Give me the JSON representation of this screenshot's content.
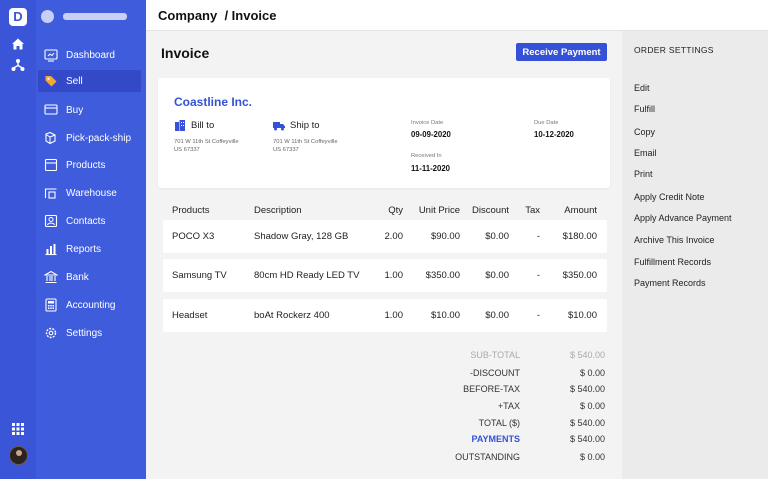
{
  "rail": {
    "logo": "D"
  },
  "sidebar": {
    "items": [
      {
        "label": "Dashboard",
        "icon": "dashboard-icon",
        "active": false
      },
      {
        "label": "Sell",
        "icon": "tag-icon",
        "active": true
      },
      {
        "label": "Buy",
        "icon": "cart-icon",
        "active": false
      },
      {
        "label": "Pick-pack-ship",
        "icon": "box-icon",
        "active": false
      },
      {
        "label": "Products",
        "icon": "products-icon",
        "active": false
      },
      {
        "label": "Warehouse",
        "icon": "warehouse-icon",
        "active": false
      },
      {
        "label": "Contacts",
        "icon": "contacts-icon",
        "active": false
      },
      {
        "label": "Reports",
        "icon": "reports-icon",
        "active": false
      },
      {
        "label": "Bank",
        "icon": "bank-icon",
        "active": false
      },
      {
        "label": "Accounting",
        "icon": "accounting-icon",
        "active": false
      },
      {
        "label": "Settings",
        "icon": "gear-icon",
        "active": false
      }
    ]
  },
  "header": {
    "breadcrumb": "Company  / Invoice"
  },
  "main": {
    "title": "Invoice",
    "receive_payment_label": "Receive Payment"
  },
  "invoice": {
    "company": "Coastline Inc.",
    "bill_to_label": "Bill to",
    "ship_to_label": "Ship to",
    "bill_to_address": [
      "701 W 11th St Coffeyville",
      "US 67337"
    ],
    "ship_to_address": [
      "701 W 11th St Coffeyville",
      "US 67337"
    ],
    "invoice_date_label": "Invoice Date",
    "invoice_date": "09-09-2020",
    "due_date_label": "Due Date",
    "due_date": "10-12-2020",
    "received_in_label": "Received In",
    "received_in": "11-11-2020"
  },
  "table": {
    "headers": [
      "Products",
      "Description",
      "Qty",
      "Unit Price",
      "Discount",
      "Tax",
      "Amount"
    ],
    "rows": [
      [
        "POCO X3",
        "Shadow Gray, 128 GB",
        "2.00",
        "$90.00",
        "$0.00",
        "-",
        "$180.00"
      ],
      [
        "Samsung TV",
        "80cm HD Ready LED TV",
        "1.00",
        "$350.00",
        "$0.00",
        "-",
        "$350.00"
      ],
      [
        "Headset",
        "boAt Rockerz 400",
        "1.00",
        "$10.00",
        "$0.00",
        "-",
        "$10.00"
      ]
    ]
  },
  "totals": [
    {
      "label": "SUB-TOTAL",
      "value": "$ 540.00"
    },
    {
      "label": "-DISCOUNT",
      "value": "$ 0.00"
    },
    {
      "label": "BEFORE-TAX",
      "value": "$ 540.00"
    },
    {
      "label": "+TAX",
      "value": "$ 0.00"
    },
    {
      "label": "TOTAL ($)",
      "value": "$ 540.00"
    },
    {
      "label": "PAYMENTS",
      "value": "$ 540.00"
    },
    {
      "label": "OUTSTANDING",
      "value": "$ 0.00"
    }
  ],
  "order_settings": {
    "title": "ORDER SETTINGS",
    "items": [
      "Edit",
      "Fulfill",
      "Copy",
      "Email",
      "Print",
      "Apply Credit Note",
      "Apply Advance Payment",
      "Archive This Invoice",
      "Fulfillment Records",
      "Payment Records"
    ]
  },
  "colors": {
    "accent": "#3451d8",
    "sidebar": "#3f5cdd",
    "rail": "#3a55d8",
    "muted_total": "#aaaaaa"
  }
}
